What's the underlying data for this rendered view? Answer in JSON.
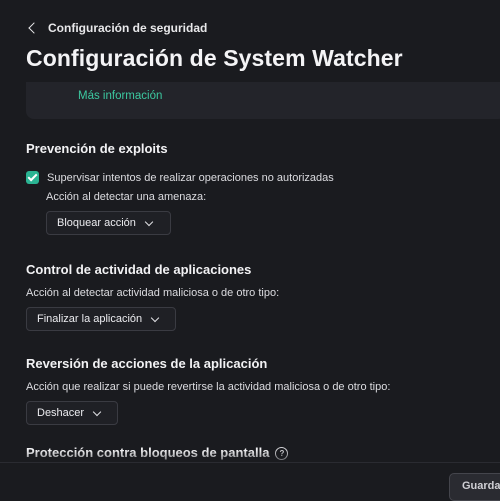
{
  "header": {
    "back_label": "Configuración de seguridad",
    "title": "Configuración de System Watcher"
  },
  "info": {
    "more_link": "Más información"
  },
  "exploit_prevention": {
    "title": "Prevención de exploits",
    "checkbox_label": "Supervisar intentos de realizar operaciones no autorizadas",
    "checked": true,
    "action_label": "Acción al detectar una amenaza:",
    "action_value": "Bloquear acción"
  },
  "app_activity": {
    "title": "Control de actividad de aplicaciones",
    "action_label": "Acción al detectar actividad maliciosa o de otro tipo:",
    "action_value": "Finalizar la aplicación"
  },
  "rollback": {
    "title": "Reversión de acciones de la aplicación",
    "action_label": "Acción que realizar si puede revertirse la actividad maliciosa o de otro tipo:",
    "action_value": "Deshacer"
  },
  "screen_lock": {
    "title": "Protección contra bloqueos de pantalla",
    "help_symbol": "?"
  },
  "footer": {
    "save_label": "Guardar"
  },
  "colors": {
    "background": "#1a1b1f",
    "accent": "#2bb493",
    "link": "#3cc8a0"
  }
}
